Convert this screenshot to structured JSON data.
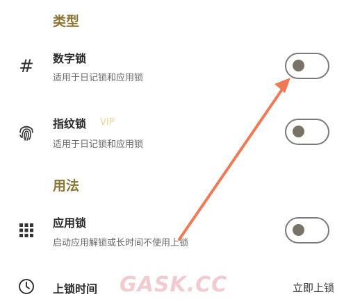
{
  "sections": {
    "type_title": "类型",
    "usage_title": "用法"
  },
  "rows": {
    "digit_lock": {
      "title": "数字锁",
      "subtitle": "适用于日记锁和应用锁",
      "icon": "hash-icon",
      "enabled": false
    },
    "fingerprint_lock": {
      "title": "指纹锁",
      "badge": "VIP",
      "subtitle": "适用于日记锁和应用锁",
      "icon": "fingerprint-icon",
      "enabled": false
    },
    "app_lock": {
      "title": "应用锁",
      "subtitle": "启动应用解锁或长时间不使用上锁",
      "icon": "grid-icon",
      "enabled": false
    },
    "lock_time": {
      "title": "上锁时间",
      "value": "立即上锁",
      "icon": "clock-icon"
    }
  },
  "watermark": "GASK.CC",
  "colors": {
    "section": "#8a7535",
    "vip": "#e8d89a",
    "arrow": "#f07a55",
    "toggle_border": "#7a7a78"
  }
}
